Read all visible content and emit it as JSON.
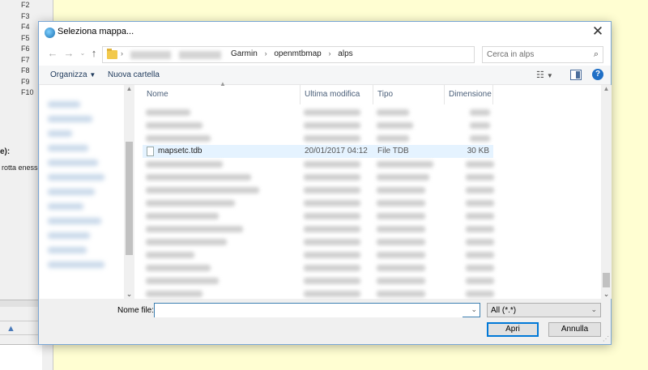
{
  "background_app": {
    "fkeys": [
      "F2",
      "F3",
      "F4",
      "F5",
      "F6",
      "F7",
      "F8",
      "F9",
      "F10"
    ],
    "label_bold": "e):",
    "label_text": "rotta enesse"
  },
  "dialog": {
    "title": "Seleziona mappa...",
    "breadcrumb": [
      "Garmin",
      "openmtbmap",
      "alps"
    ],
    "search_placeholder": "Cerca in alps",
    "toolbar": {
      "organize_label": "Organizza",
      "new_folder_label": "Nuova cartella"
    },
    "columns": {
      "name": "Nome",
      "date": "Ultima modifica",
      "type": "Tipo",
      "size": "Dimensione"
    },
    "selected_file": {
      "name": "mapsetc.tdb",
      "date": "20/01/2017 04:12",
      "type": "File TDB",
      "size": "30 KB"
    },
    "file_name_label": "Nome file:",
    "file_name_value": "",
    "filter_value": "All (*.*)",
    "open_label": "Apri",
    "cancel_label": "Annulla"
  },
  "colors": {
    "accent": "#0078d7",
    "selection": "#e5f3ff",
    "desktop": "#fffed2"
  }
}
